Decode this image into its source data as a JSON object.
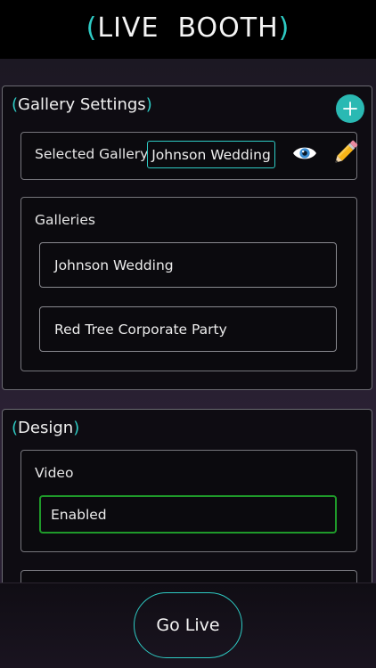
{
  "header": {
    "title_open": "(",
    "title": "LIVE  BOOTH",
    "title_close": ")"
  },
  "gallery_settings": {
    "title_open": "(",
    "title": "Gallery Settings",
    "title_close": ")",
    "add_icon": "plus-icon",
    "selected": {
      "label": "Selected Gallery",
      "value": "Johnson Wedding",
      "view_icon": "eye-icon",
      "edit_icon": "pencil-icon"
    },
    "galleries": {
      "label": "Galleries",
      "items": [
        {
          "name": "Johnson Wedding"
        },
        {
          "name": "Red Tree Corporate Party"
        }
      ]
    }
  },
  "design": {
    "title_open": "(",
    "title": "Design",
    "title_close": ")",
    "video": {
      "label": "Video",
      "value": "Enabled"
    }
  },
  "footer": {
    "go_live_label": "Go Live"
  },
  "colors": {
    "accent": "#2ecbc4",
    "enabled_border": "#1f9a2a",
    "header_bg": "#000000"
  }
}
